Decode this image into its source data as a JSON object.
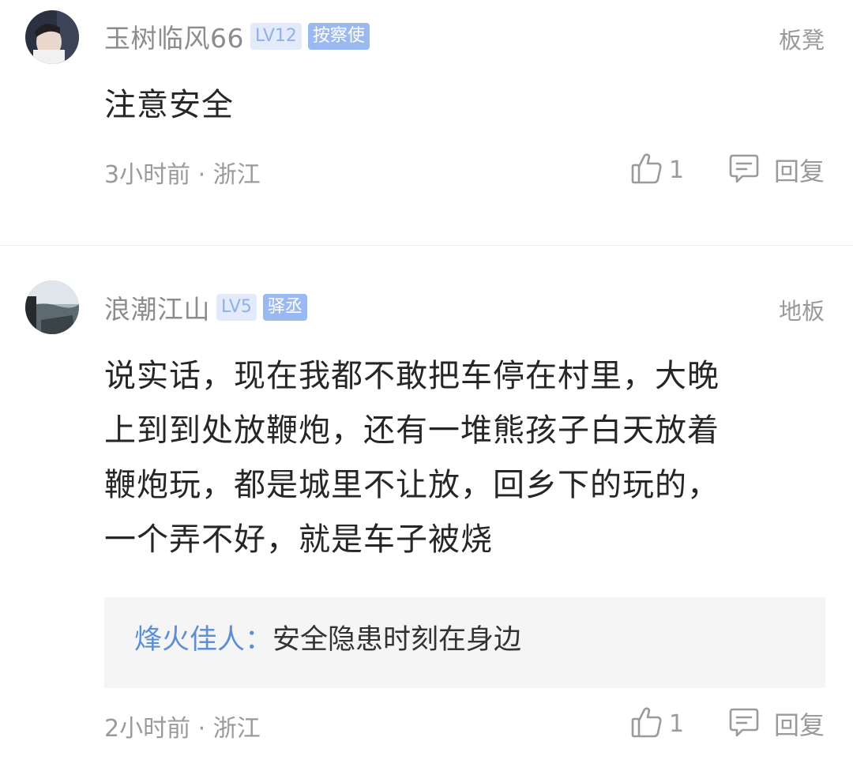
{
  "comments": [
    {
      "username": "玉树临风66",
      "level": "LV12",
      "title": "按察使",
      "floor": "板凳",
      "content": "注意安全",
      "time": "3小时前 · 浙江",
      "likes": "1",
      "reply_label": "回复"
    },
    {
      "username": "浪潮江山",
      "level": "LV5",
      "title": "驿丞",
      "floor": "地板",
      "content_lines": [
        "说实话，现在我都不敢把车停在村里，大晚",
        "上到到处放鞭炮，还有一堆熊孩子白天放着",
        "鞭炮玩，都是城里不让放，回乡下的玩的，",
        "一个弄不好，就是车子被烧"
      ],
      "sub_reply": {
        "name": "烽火佳人",
        "colon": "：",
        "text": "安全隐患时刻在身边"
      },
      "time": "2小时前 · 浙江",
      "likes": "1",
      "reply_label": "回复"
    }
  ],
  "colors": {
    "level_badge_bg": "#e3ebfb",
    "title_badge_bg": "#9ab9f0",
    "reply_name": "#5e8fd6",
    "meta_gray": "#9a9a9a"
  },
  "icons": {
    "like": "thumbs-up-icon",
    "reply": "comment-bubble-icon"
  }
}
